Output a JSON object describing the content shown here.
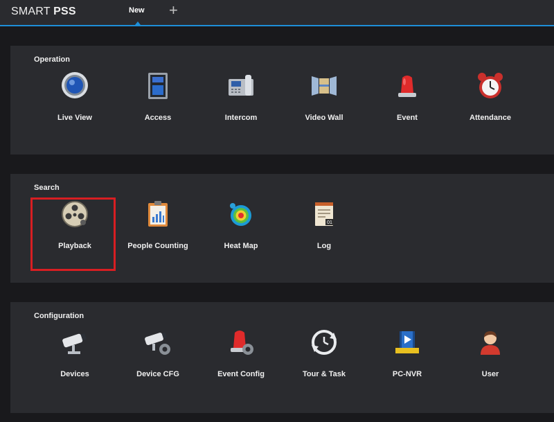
{
  "app": {
    "brand_light": "SMART ",
    "brand_bold": "PSS"
  },
  "tabs": [
    {
      "label": "New"
    }
  ],
  "add_tab": "+",
  "sections": [
    {
      "title": "Operation",
      "items": [
        {
          "label": "Live View",
          "icon": "live-view-icon"
        },
        {
          "label": "Access",
          "icon": "access-icon"
        },
        {
          "label": "Intercom",
          "icon": "intercom-icon"
        },
        {
          "label": "Video Wall",
          "icon": "video-wall-icon"
        },
        {
          "label": "Event",
          "icon": "event-icon"
        },
        {
          "label": "Attendance",
          "icon": "alarm-clock-icon"
        }
      ]
    },
    {
      "title": "Search",
      "items": [
        {
          "label": "Playback",
          "icon": "film-reel-icon"
        },
        {
          "label": "People Counting",
          "icon": "people-counting-icon"
        },
        {
          "label": "Heat Map",
          "icon": "heat-map-icon"
        },
        {
          "label": "Log",
          "icon": "log-icon"
        }
      ]
    },
    {
      "title": "Configuration",
      "items": [
        {
          "label": "Devices",
          "icon": "camera-icon"
        },
        {
          "label": "Device CFG",
          "icon": "camera-gear-icon"
        },
        {
          "label": "Event Config",
          "icon": "event-gear-icon"
        },
        {
          "label": "Tour & Task",
          "icon": "tour-clock-icon"
        },
        {
          "label": "PC-NVR",
          "icon": "pc-nvr-icon"
        },
        {
          "label": "User",
          "icon": "user-icon"
        }
      ]
    }
  ],
  "colors": {
    "accent": "#1e8fd8",
    "highlight": "#d81e22",
    "panel": "#2a2b2f"
  }
}
